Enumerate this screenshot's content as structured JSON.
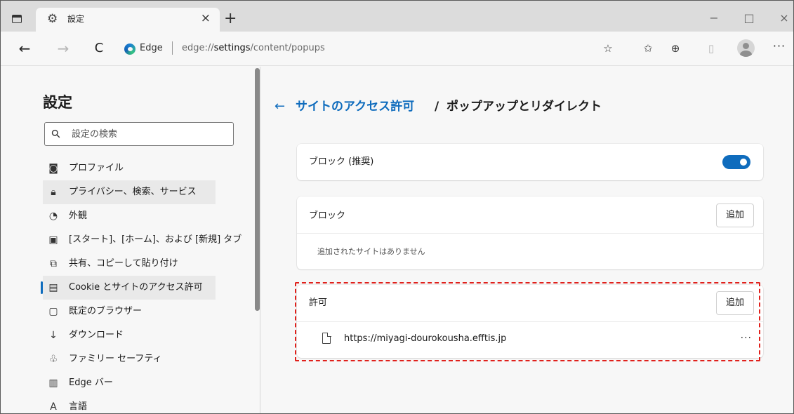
{
  "browser": {
    "tab": {
      "title": "設定",
      "icon": "gear-icon",
      "close": "×"
    },
    "new_tab": "+",
    "window_controls": {
      "minimize": "−",
      "maximize": "□",
      "close": "×"
    },
    "nav": {
      "back": "←",
      "forward": "→",
      "refresh": "C"
    },
    "address": {
      "origin": "Edge",
      "url_prefix": "edge://",
      "url_bold": "settings",
      "url_suffix": "/content/popups"
    },
    "toolbar_icons": [
      "add-favorite-icon",
      "favorites-icon",
      "collections-icon",
      "read-aloud-icon",
      "profile-icon",
      "more-icon"
    ],
    "more": "···"
  },
  "sidebar": {
    "title": "設定",
    "search_placeholder": "設定の検索",
    "items": [
      {
        "label": "プロファイル",
        "icon": "profile-icon",
        "glyph": "◙"
      },
      {
        "label": "プライバシー、検索、サービス",
        "icon": "lock-icon",
        "glyph": "🔒︎"
      },
      {
        "label": "外観",
        "icon": "appearance-icon",
        "glyph": "◔"
      },
      {
        "label": "[スタート]、[ホーム]、および [新規] タブ",
        "icon": "home-tab-icon",
        "glyph": "▣"
      },
      {
        "label": "共有、コピーして貼り付け",
        "icon": "share-icon",
        "glyph": "⧉"
      },
      {
        "label": "Cookie とサイトのアクセス許可",
        "icon": "site-permissions-icon",
        "glyph": "▤"
      },
      {
        "label": "既定のブラウザー",
        "icon": "default-browser-icon",
        "glyph": "▢"
      },
      {
        "label": "ダウンロード",
        "icon": "download-icon",
        "glyph": "↓"
      },
      {
        "label": "ファミリー セーフティ",
        "icon": "family-icon",
        "glyph": "♧"
      },
      {
        "label": "Edge バー",
        "icon": "edge-bar-icon",
        "glyph": "▥"
      },
      {
        "label": "言語",
        "icon": "language-icon",
        "glyph": "A"
      }
    ],
    "hover_index": 1,
    "selected_index": 5
  },
  "main": {
    "breadcrumb": {
      "back": "←",
      "parent": "サイトのアクセス許可",
      "separator": "/",
      "current": "ポップアップとリダイレクト"
    },
    "block_setting": {
      "label": "ブロック (推奨)",
      "toggle_on": true
    },
    "block_section": {
      "label": "ブロック",
      "add_button": "追加",
      "empty_text": "追加されたサイトはありません"
    },
    "allow_section": {
      "label": "許可",
      "add_button": "追加",
      "sites": [
        "https://miyagi-dourokousha.efftis.jp"
      ],
      "site_more": "···"
    }
  },
  "colors": {
    "accent": "#0f6cbd",
    "highlight": "#e0201b",
    "selected_marker": "#0f6cbd"
  }
}
